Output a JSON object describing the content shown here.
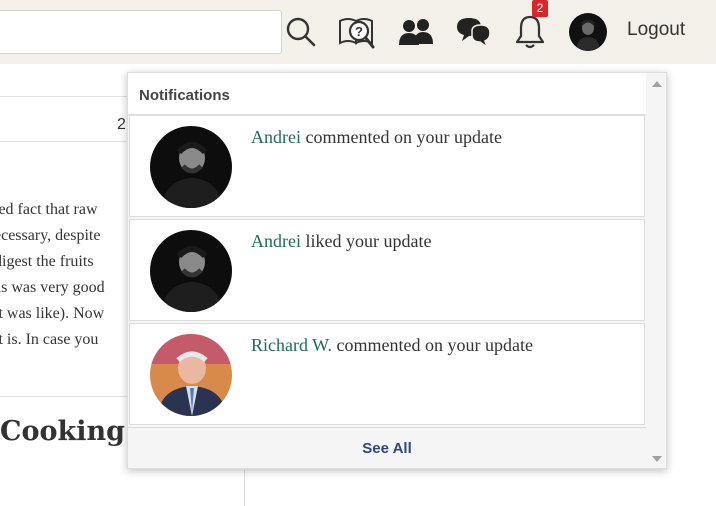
{
  "search": {
    "value": "",
    "placeholder": ""
  },
  "header": {
    "icons": [
      "search-icon",
      "help-book-icon",
      "people-icon",
      "chat-icon",
      "bell-icon"
    ],
    "notification_count": "2",
    "logout_label": "Logout"
  },
  "background": {
    "row_number": "2",
    "lines": [
      "ted fact that raw",
      "ecessary, despite",
      "digest the fruits",
      "as was very good",
      "it was like). Now",
      "it is. In case you"
    ],
    "heading": "Cooking"
  },
  "notifications": {
    "title": "Notifications",
    "items": [
      {
        "name": "Andrei",
        "action": " commented on your update",
        "avatar": "dark-photo"
      },
      {
        "name": "Andrei",
        "action": " liked your update",
        "avatar": "dark-photo"
      },
      {
        "name": "Richard W.",
        "action": " commented on your update",
        "avatar": "color-photo"
      }
    ],
    "see_all_label": "See All"
  },
  "colors": {
    "topbar_bg": "#f3f0ea",
    "link_name": "#1e6b5c",
    "see_all": "#2b4a7a",
    "badge": "#d9262c"
  }
}
